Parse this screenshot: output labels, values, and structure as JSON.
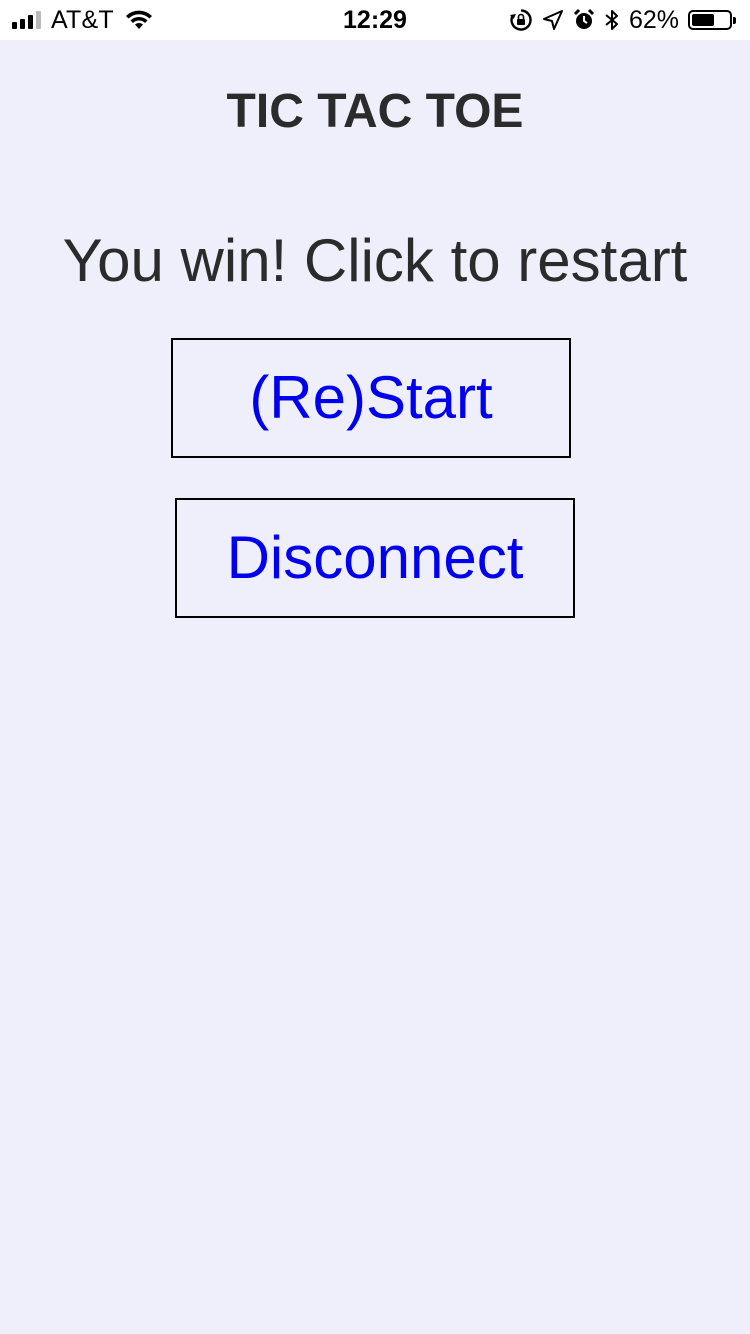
{
  "status_bar": {
    "carrier": "AT&T",
    "time": "12:29",
    "battery_percent": "62%",
    "battery_level": 0.62,
    "signal_bars_active": 3,
    "signal_bars_total": 4,
    "icons": [
      "signal-icon",
      "wifi-icon",
      "rotation-lock-icon",
      "location-icon",
      "alarm-icon",
      "bluetooth-icon",
      "battery-icon"
    ]
  },
  "game": {
    "title": "TIC TAC TOE",
    "message": "You win! Click to restart",
    "restart_label": "(Re)Start",
    "disconnect_label": "Disconnect"
  },
  "colors": {
    "background": "#efeffb",
    "text": "#2b2b2b",
    "link": "#0000ee",
    "border": "#000000"
  }
}
